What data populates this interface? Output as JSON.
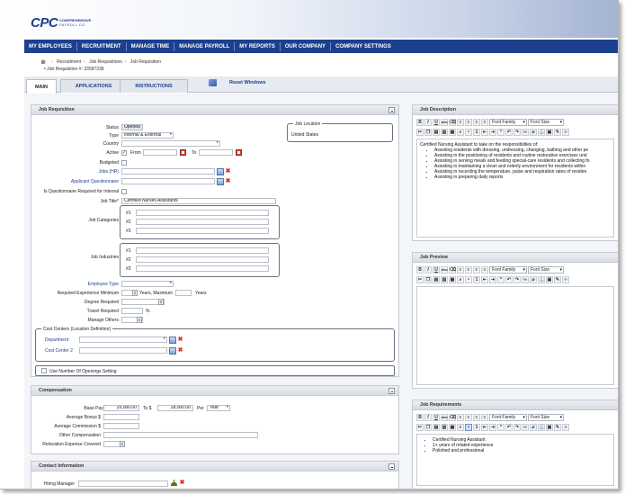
{
  "logo": {
    "mark": "CPC",
    "line1": "COMPREHENSIVE",
    "line2": "PAYROLL CO."
  },
  "nav": [
    "MY EMPLOYEES",
    "RECRUITMENT",
    "MANAGE TIME",
    "MANAGE PAYROLL",
    "MY REPORTS",
    "OUR COMPANY",
    "COMPANY SETTINGS"
  ],
  "breadcrumb": {
    "items": [
      "Recruitment",
      "Job Requisitions",
      "Job Requisition"
    ],
    "req_number": "Job Requisition #: 33587338"
  },
  "tabs": [
    "MAIN",
    "APPLICATIONS",
    "INSTRUCTIONS"
  ],
  "reset_windows": "Reset Windows",
  "job_requisition": {
    "title": "Job Requisition",
    "status_label": "Status",
    "status_value": "Opened",
    "type_label": "Type",
    "type_value": "Internal & External",
    "country_label": "Country",
    "country_value": "",
    "active_label": "Active",
    "from_label": "From",
    "to_label": "To",
    "budgeted_label": "Budgeted",
    "jobs_hr_label": "Jobs (HR)",
    "questionnaire_label": "Applicant Questionnaire",
    "questionnaire_required_label": "Is Questionnaire Required for Internal",
    "job_title_label": "Job Title*",
    "job_title_value": "Certified Nurses Assistants",
    "job_location_title": "Job Location",
    "job_location_value": "United States",
    "job_categories_label": "Job Categories",
    "job_industries_label": "Job Industries",
    "slots": [
      "#1",
      "#2",
      "#3"
    ],
    "employee_type_label": "Employee Type",
    "experience_label": "Required Experience Minimum",
    "years_maximum": "Years, Maximum",
    "years": "Years",
    "degree_label": "Degree Required",
    "travel_label": "Travel Required",
    "percent": "%",
    "manage_others_label": "Manage Others",
    "cost_centers_title": "Cost Centers (Location Definition)",
    "department_label": "Department",
    "cost_center2_label": "Cost Center 2",
    "openings_label": "Use Number Of Openings Setting"
  },
  "compensation": {
    "title": "Compensation",
    "base_pay_label": "Base Pay From $",
    "base_from": "25,000.00",
    "to_label": "To $",
    "base_to": "28,000.00",
    "per_label": "Per",
    "per_value": "Year",
    "avg_bonus_label": "Average Bonus $",
    "avg_commission_label": "Average Commission $",
    "other_label": "Other Compensation",
    "relocation_label": "Relocation Expense Covered"
  },
  "contact": {
    "title": "Contact Information",
    "hiring_manager_label": "Hiring Manager"
  },
  "editor": {
    "font_family": "Font Family",
    "font_size": "Font Size"
  },
  "job_description": {
    "title": "Job Description",
    "intro": "Certified Nursing Assistant to take on the responsibilities of:",
    "items": [
      "Assisting residents with dressing, undressing, changing, bathing and other pe",
      "Assisting in the positioning of residents and routine restorative exercises und",
      "Assisting in serving meals and feeding special-care residents and collecting fo",
      "Assisting in maintaining a clean and orderly environment for residents within",
      "Assisting in recording the temperature, pulse and respiration rates of residen",
      "Assisting in preparing daily reports"
    ]
  },
  "job_preview": {
    "title": "Job Preview"
  },
  "job_requirements": {
    "title": "Job Requirements",
    "items": [
      "Certified Nursing Assistant",
      "1+ years of related experience",
      "Polished and professional"
    ]
  }
}
